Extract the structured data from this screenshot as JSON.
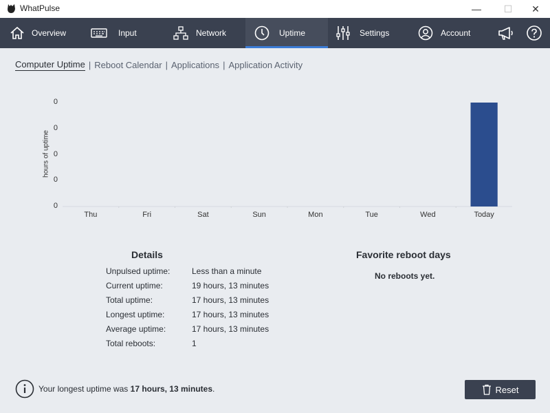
{
  "window": {
    "title": "WhatPulse",
    "minimize": "—",
    "maximize": "☐",
    "close": "✕"
  },
  "nav": {
    "items": [
      {
        "label": "Overview",
        "icon": "home-icon"
      },
      {
        "label": "Input",
        "icon": "keyboard-icon"
      },
      {
        "label": "Network",
        "icon": "network-icon"
      },
      {
        "label": "Uptime",
        "icon": "clock-icon",
        "active": true
      },
      {
        "label": "Settings",
        "icon": "sliders-icon"
      },
      {
        "label": "Account",
        "icon": "user-icon"
      }
    ],
    "extra_icons": [
      "megaphone-icon",
      "help-icon"
    ]
  },
  "subtabs": [
    "Computer Uptime",
    "Reboot Calendar",
    "Applications",
    "Application Activity"
  ],
  "chart_data": {
    "type": "bar",
    "ylabel": "hours of uptime",
    "yticks": [
      "0",
      "0",
      "0",
      "0",
      "0"
    ],
    "categories": [
      "Thu",
      "Fri",
      "Sat",
      "Sun",
      "Mon",
      "Tue",
      "Wed",
      "Today"
    ],
    "values": [
      0,
      0,
      0,
      0,
      0,
      0,
      0,
      1
    ],
    "bar_color": "#2b4d8e",
    "grid": false
  },
  "details": {
    "title": "Details",
    "rows": [
      {
        "label": "Unpulsed uptime:",
        "value": "Less than a minute"
      },
      {
        "label": "Current uptime:",
        "value": "19 hours, 13 minutes"
      },
      {
        "label": "Total uptime:",
        "value": "17 hours, 13 minutes"
      },
      {
        "label": "Longest uptime:",
        "value": "17 hours, 13 minutes"
      },
      {
        "label": "Average uptime:",
        "value": "17 hours, 13 minutes"
      },
      {
        "label": "Total reboots:",
        "value": "1"
      }
    ]
  },
  "favorites": {
    "title": "Favorite reboot days",
    "text": "No reboots yet."
  },
  "footer": {
    "prefix": "Your longest uptime was ",
    "value": "17 hours, 13 minutes",
    "suffix": ".",
    "reset_label": "Reset"
  },
  "colors": {
    "nav_bg": "#3a4150",
    "accent": "#3a7bd5",
    "page_bg": "#e9ecf0"
  }
}
